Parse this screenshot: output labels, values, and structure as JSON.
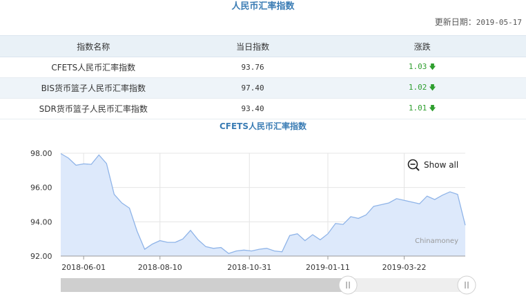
{
  "page_title": "人民币汇率指数",
  "update": {
    "label": "更新日期：",
    "date": "2019-05-17"
  },
  "table": {
    "headers": [
      "指数名称",
      "当日指数",
      "涨跌"
    ],
    "rows": [
      {
        "name": "CFETS人民币汇率指数",
        "value": "93.76",
        "change": "1.03",
        "direction": "down"
      },
      {
        "name": "BIS货币篮子人民币汇率指数",
        "value": "97.40",
        "change": "1.02",
        "direction": "down"
      },
      {
        "name": "SDR货币篮子人民币汇率指数",
        "value": "93.40",
        "change": "1.01",
        "direction": "down"
      }
    ],
    "down_arrow": "down-arrow-icon"
  },
  "chart_data": {
    "type": "area",
    "title": "CFETS人民币汇率指数",
    "watermark": "Chinamoney",
    "show_all_label": "Show all",
    "ylim": [
      92,
      98
    ],
    "y_ticks": [
      "98.00",
      "96.00",
      "94.00",
      "92.00"
    ],
    "x_ticks": [
      "2018-06-01",
      "2018-08-10",
      "2018-10-31",
      "2019-01-11",
      "2019-03-22"
    ],
    "x_tick_dates": [
      "2018-06-01",
      "2018-08-10",
      "2018-10-31",
      "2019-01-11",
      "2019-03-22"
    ],
    "x_range": [
      "2018-05-11",
      "2019-05-17"
    ],
    "grid": true,
    "fill_color": "#dde9fb",
    "line_color": "#8fb4e8",
    "series": [
      {
        "dates": [
          "2018-05-11",
          "2018-05-18",
          "2018-05-25",
          "2018-06-01",
          "2018-06-08",
          "2018-06-15",
          "2018-06-22",
          "2018-06-29",
          "2018-07-06",
          "2018-07-13",
          "2018-07-20",
          "2018-07-27",
          "2018-08-03",
          "2018-08-10",
          "2018-08-17",
          "2018-08-24",
          "2018-08-31",
          "2018-09-07",
          "2018-09-14",
          "2018-09-21",
          "2018-09-28",
          "2018-10-05",
          "2018-10-12",
          "2018-10-19",
          "2018-10-26",
          "2018-11-02",
          "2018-11-09",
          "2018-11-16",
          "2018-11-23",
          "2018-11-30",
          "2018-12-07",
          "2018-12-14",
          "2018-12-21",
          "2018-12-28",
          "2019-01-04",
          "2019-01-11",
          "2019-01-18",
          "2019-01-25",
          "2019-02-01",
          "2019-02-08",
          "2019-02-15",
          "2019-02-22",
          "2019-03-01",
          "2019-03-08",
          "2019-03-15",
          "2019-03-22",
          "2019-03-29",
          "2019-04-05",
          "2019-04-12",
          "2019-04-19",
          "2019-04-26",
          "2019-05-03",
          "2019-05-10",
          "2019-05-17"
        ],
        "values": [
          97.98,
          97.72,
          97.3,
          97.38,
          97.35,
          97.9,
          97.4,
          95.6,
          95.1,
          94.8,
          93.45,
          92.4,
          92.7,
          92.9,
          92.8,
          92.8,
          93.0,
          93.5,
          92.95,
          92.55,
          92.45,
          92.5,
          92.15,
          92.3,
          92.35,
          92.3,
          92.4,
          92.45,
          92.3,
          92.25,
          93.2,
          93.3,
          92.9,
          93.25,
          92.95,
          93.3,
          93.9,
          93.85,
          94.3,
          94.2,
          94.4,
          94.9,
          95.0,
          95.1,
          95.35,
          95.25,
          95.15,
          95.05,
          95.5,
          95.3,
          95.55,
          95.75,
          95.6,
          93.8
        ]
      }
    ],
    "slider": {
      "start_fraction": 0.0,
      "end_fraction": 1.0,
      "selected_from_fraction": 0.71
    }
  }
}
